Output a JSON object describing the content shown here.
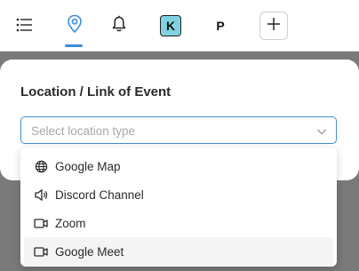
{
  "toolbar": {
    "items": [
      {
        "name": "list-icon"
      },
      {
        "name": "location-pin-icon",
        "active": true
      },
      {
        "name": "bell-icon"
      },
      {
        "name": "k-avatar",
        "label": "K"
      },
      {
        "name": "p-avatar",
        "label": "P"
      },
      {
        "name": "plus-icon"
      }
    ],
    "accent_color": "#3a8de0",
    "avatar_bg": "#7fd3e1"
  },
  "location_panel": {
    "title": "Location / Link of Event",
    "select": {
      "placeholder": "Select location type",
      "options": [
        {
          "label": "Google Map",
          "icon": "globe-icon"
        },
        {
          "label": "Discord Channel",
          "icon": "speaker-icon"
        },
        {
          "label": "Zoom",
          "icon": "video-camera-icon"
        },
        {
          "label": "Google Meet",
          "icon": "video-camera-icon",
          "hovered": true
        }
      ]
    }
  }
}
